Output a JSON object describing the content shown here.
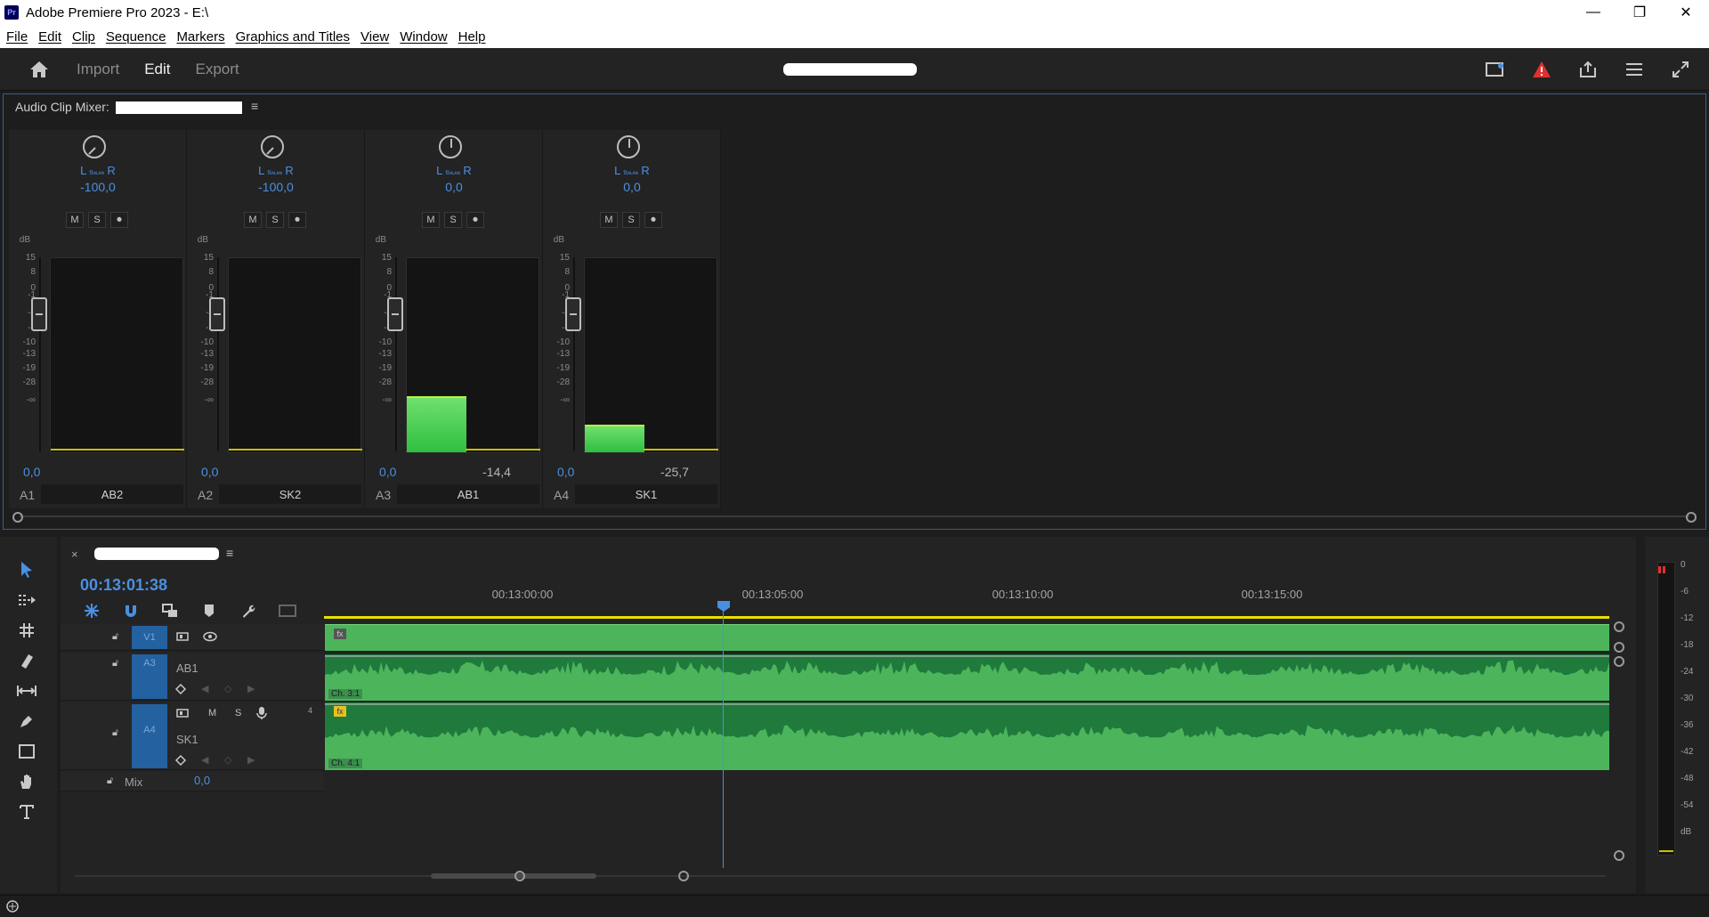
{
  "window": {
    "app_icon": "Pr",
    "title": "Adobe Premiere Pro 2023 - E:\\",
    "controls": [
      "minimize-icon",
      "restore-icon",
      "close-icon"
    ]
  },
  "menubar": {
    "items": [
      "File",
      "Edit",
      "Clip",
      "Sequence",
      "Markers",
      "Graphics and Titles",
      "View",
      "Window",
      "Help"
    ]
  },
  "header": {
    "home_icon": "home-icon",
    "tabs": [
      {
        "label": "Import",
        "active": false
      },
      {
        "label": "Edit",
        "active": true
      },
      {
        "label": "Export",
        "active": false
      }
    ],
    "right_icons": [
      "workspace-icon",
      "warning-icon",
      "share-icon",
      "menu-icon",
      "fullscreen-icon"
    ]
  },
  "mixer": {
    "panel_title": "Audio Clip Mixer:",
    "panel_menu": "≡",
    "db_label": "dB",
    "scale_ticks": [
      "15",
      "8",
      "0",
      "-1",
      "-4",
      "-7",
      "-10",
      "-13",
      "-19",
      "-28",
      "-∞"
    ],
    "channels": [
      {
        "lr_left": "L",
        "lr_mid": "Ɓᴀʟᴀɴ",
        "lr_right": "R",
        "pan": "-100,0",
        "m": "M",
        "s": "S",
        "volume": "0,0",
        "peak": "",
        "level": 0.0,
        "track_id": "A1",
        "track_name": "AB2"
      },
      {
        "lr_left": "L",
        "lr_mid": "Ɓᴀʟᴀɴ",
        "lr_right": "R",
        "pan": "-100,0",
        "m": "M",
        "s": "S",
        "volume": "0,0",
        "peak": "",
        "level": 0.0,
        "track_id": "A2",
        "track_name": "SK2"
      },
      {
        "lr_left": "L",
        "lr_mid": "Ɓᴀʟᴀɴ",
        "lr_right": "R",
        "pan": "0,0",
        "m": "M",
        "s": "S",
        "volume": "0,0",
        "peak": "-14,4",
        "level": 0.29,
        "track_id": "A3",
        "track_name": "AB1"
      },
      {
        "lr_left": "L",
        "lr_mid": "Ɓᴀʟᴀɴ",
        "lr_right": "R",
        "pan": "0,0",
        "m": "M",
        "s": "S",
        "volume": "0,0",
        "peak": "-25,7",
        "level": 0.14,
        "track_id": "A4",
        "track_name": "SK1"
      }
    ]
  },
  "timeline": {
    "close": "×",
    "menu": "≡",
    "timecode": "00:13:01:38",
    "ruler_labels": [
      "00:13:00:00",
      "00:13:05:00",
      "00:13:10:00",
      "00:13:15:00"
    ],
    "tracks": [
      {
        "id": "V1",
        "type": "video"
      },
      {
        "id": "A3",
        "name": "AB1",
        "channel_label": "Ch. 3:1",
        "type": "audio"
      },
      {
        "id": "A4",
        "name": "SK1",
        "channel_label": "Ch. 4:1",
        "type": "audio",
        "track_num": "4",
        "m": "M",
        "s": "S"
      }
    ],
    "mix_label": "Mix",
    "mix_value": "0,0"
  },
  "tools": [
    "selection-tool-icon",
    "track-select-icon",
    "ripple-edit-icon",
    "razor-icon",
    "slip-icon",
    "pen-icon",
    "rectangle-icon",
    "hand-icon",
    "type-icon"
  ],
  "audio_meter": {
    "ticks": [
      "0",
      "-6",
      "-12",
      "-18",
      "-24",
      "-30",
      "-36",
      "-42",
      "-48",
      "-54",
      "dB"
    ]
  },
  "colors": {
    "accent_blue": "#4a90e2",
    "clip_green": "#4cb55c",
    "audio_clip_dark": "#1f7a3c",
    "workarea_yellow": "#e8e000",
    "warning_red": "#e03030"
  }
}
